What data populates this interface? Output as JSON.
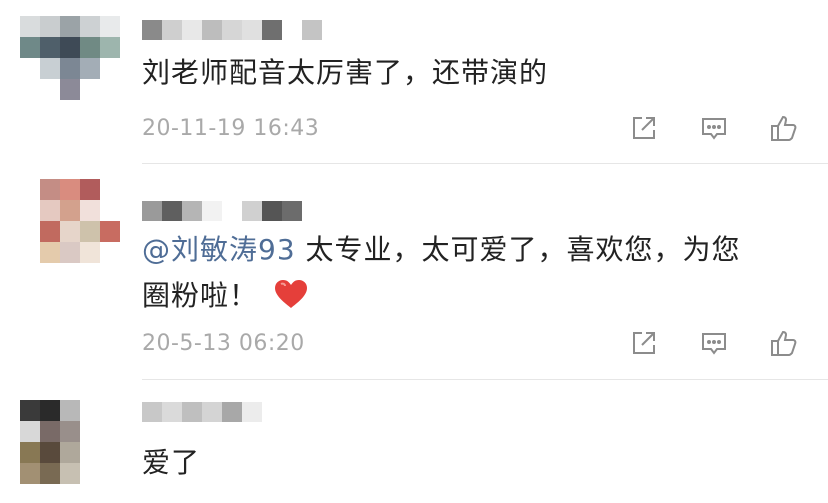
{
  "comments": [
    {
      "text": "刘老师配音太厉害了，还带演的",
      "time": "20-11-19 16:43"
    },
    {
      "mention": "@刘敏涛93",
      "text_line1": "太专业，太可爱了，喜欢您，为您",
      "text_line2": "圈粉啦！",
      "time": "20-5-13 06:20"
    },
    {
      "text": "爱了"
    }
  ],
  "actions": {
    "share_icon": "share-icon",
    "comment_icon": "comment-icon",
    "like_icon": "like-icon"
  }
}
